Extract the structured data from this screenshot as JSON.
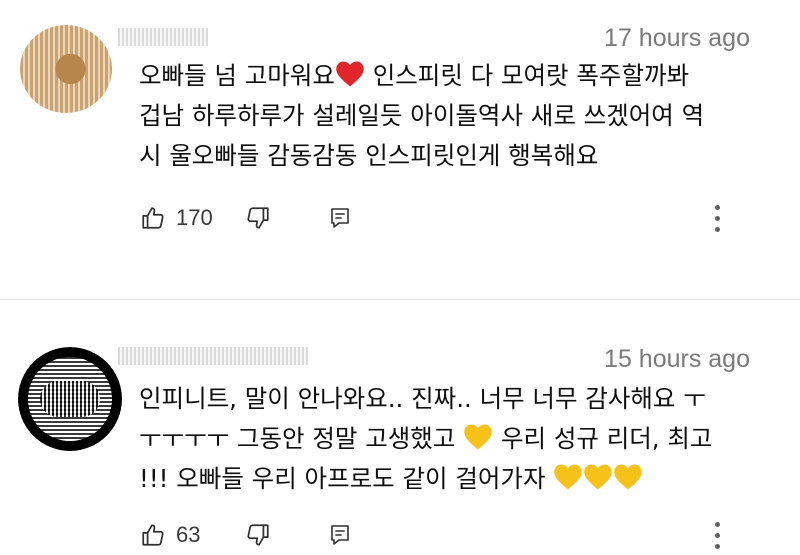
{
  "comments": [
    {
      "timestamp": "17 hours ago",
      "lines": [
        {
          "before": "오빠들 넘 고마워요",
          "emoji": "red-heart",
          "after": " 인스피릿 다 모여랏 폭주할까봐"
        },
        {
          "text": "겁남 하루하루가 설레일듯 아이돌역사 새로 쓰겠어여 역"
        },
        {
          "text": "시 울오빠들 감동감동 인스피릿인게 행복해요"
        }
      ],
      "like_count": "170"
    },
    {
      "timestamp": "15 hours ago",
      "lines": [
        {
          "text": "인피니트, 말이 안나와요.. 진짜.. 너무 너무 감사해요 ㅜ"
        },
        {
          "before": "ㅜㅜㅜㅜ 그동안 정말 고생했고 ",
          "emoji": "yellow-heart",
          "after": " 우리 성규 리더, 최고"
        },
        {
          "before": "!!! 오빠들 우리 아프로도 같이 걸어가자 ",
          "emoji3": "yellow-heart"
        }
      ],
      "like_count": "63"
    }
  ],
  "icons": {
    "like": "thumb-up-icon",
    "dislike": "thumb-down-icon",
    "reply": "reply-icon",
    "more": "more-vert-icon"
  },
  "colors": {
    "red_heart": "#e0262b",
    "yellow_heart": "#f6c21a",
    "icon": "#303030",
    "timestamp": "#7a7a7a"
  }
}
